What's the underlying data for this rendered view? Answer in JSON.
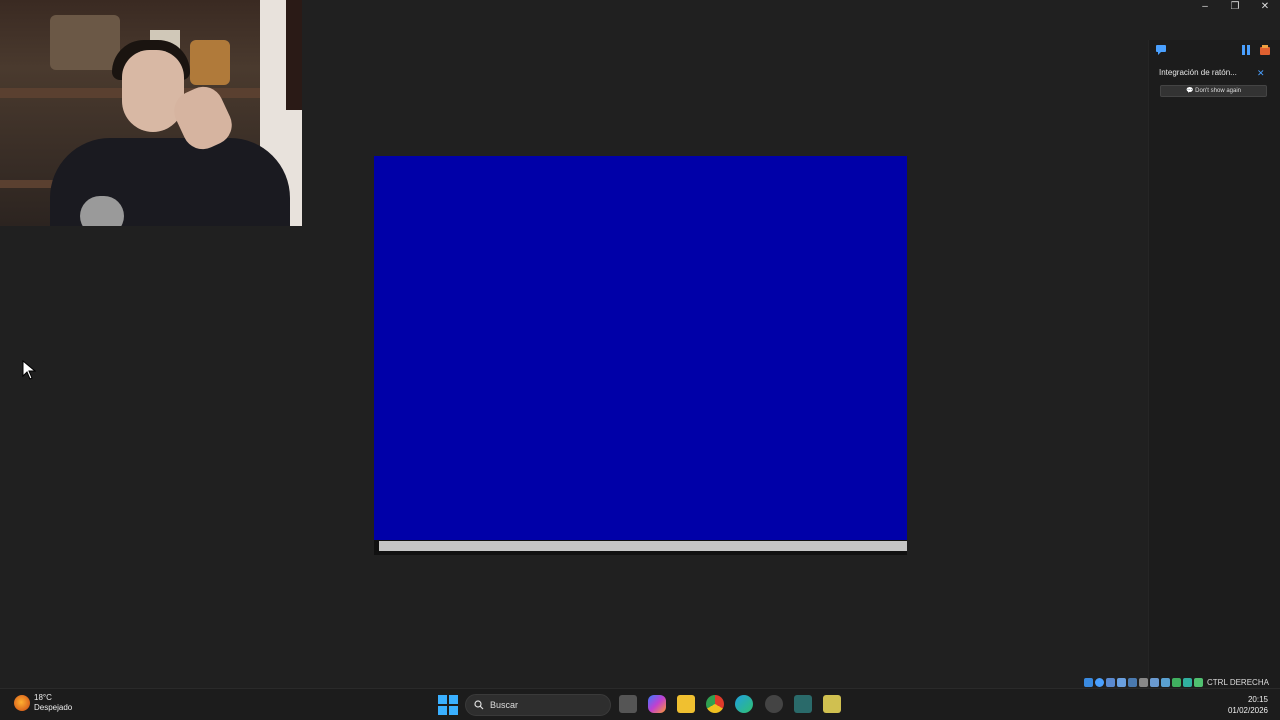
{
  "window": {
    "minimize_glyph": "–",
    "restore_glyph": "❐",
    "close_glyph": "✕"
  },
  "notification": {
    "title": "Integración de ratón...",
    "button_label": "Don't show again"
  },
  "vm_tray": {
    "host_key": "CTRL DERECHA"
  },
  "taskbar": {
    "weather_temp": "18°C",
    "weather_desc": "Despejado",
    "search_placeholder": "Buscar",
    "time": "20:15",
    "date": "01/02/2026",
    "apps": [
      "task-view-icon",
      "copilot-icon",
      "file-explorer-icon",
      "chrome-icon",
      "edge-icon",
      "settings-icon",
      "visual-studio-icon",
      "notepad-icon"
    ]
  },
  "colors": {
    "vm_screen": "#0000a8",
    "progress": "#c6c6c6",
    "background": "#202020",
    "accent": "#3ab0ff"
  }
}
